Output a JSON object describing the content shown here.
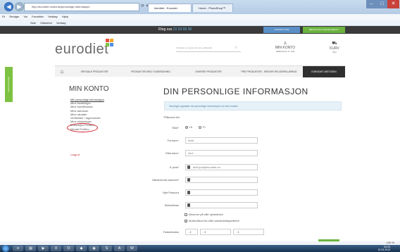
{
  "browser": {
    "address": "http://eurodiet.no/konto/personlige-informasjon",
    "tabs": [
      "Identitet - Eurodiet",
      "Home - PhotoShop™"
    ]
  },
  "menubar": [
    "Fil",
    "Rediger",
    "Vis",
    "Favoritter",
    "Verktøy",
    "Hjelp"
  ],
  "cmdbar": [
    "Side",
    "Sikkerhet",
    "Verktøy"
  ],
  "topstrip": {
    "phone_label": "Ring oss",
    "phone_number": "22 93 66 00",
    "btn1": "KONTAKT OSS",
    "btn2": "BESTILLING ONLINE RABATT"
  },
  "header": {
    "logo": "eurodiet",
    "search_placeholder": "Produkter en guide på meny alfabetisk",
    "account_title": "MIN KONTO",
    "account_sub": "Velkommen, A. Juul",
    "cart_title": "KURV",
    "cart_sub": "Tom"
  },
  "nav": [
    "SPESIALE PRODUKTER",
    "PRODUKTER MED TILBEREDNING",
    "DIVERSE PRODUKTER",
    "PRE PRODUKTER - KREVER HELSEERKLÆRING",
    "EURODIET-METODEN"
  ],
  "sidetab": "Kontakt Eurodiet",
  "sidebar": {
    "title": "MIN KONTO",
    "items": [
      "Min personlige informasjon",
      "Mine bestillinger",
      "Mine kredittnotaer",
      "Mine adresser",
      "Mine rabatter",
      "Ventelister / lagervarsler",
      "Mine erklæringer",
      "Motivasjon Profilen",
      "Mental Profilen"
    ],
    "logout": "Logg ut"
  },
  "main": {
    "title": "DIN PERSONLIGE INFORMASJON",
    "notice": "Vennligst oppdater din personlige informasjon om den endres",
    "required_note": "*Påkrevd felt",
    "labels": {
      "title": "Tittel",
      "firstname": "Fornavn",
      "lastname": "Etternavn",
      "email": "E-post",
      "current_pw": "Nåværende passord",
      "new_pw": "Nytt Passord",
      "confirm": "Bekreftelse",
      "birth": "Fødselsdato"
    },
    "radios": [
      "Hr",
      "Fr"
    ],
    "values": {
      "firstname": "Arild",
      "lastname": "Juul",
      "email": "arild.juul@eurodiet.no"
    },
    "birth_selects": [
      "-",
      "-",
      "-"
    ],
    "checkboxes": [
      "Abonner på vårt nyhetsbrev",
      "Motta tilbud fra våre samarbeidspartnere"
    ]
  },
  "status": {
    "zoom": "100 %"
  },
  "tray": {
    "time": "09:29",
    "date": "13.03.2013"
  }
}
